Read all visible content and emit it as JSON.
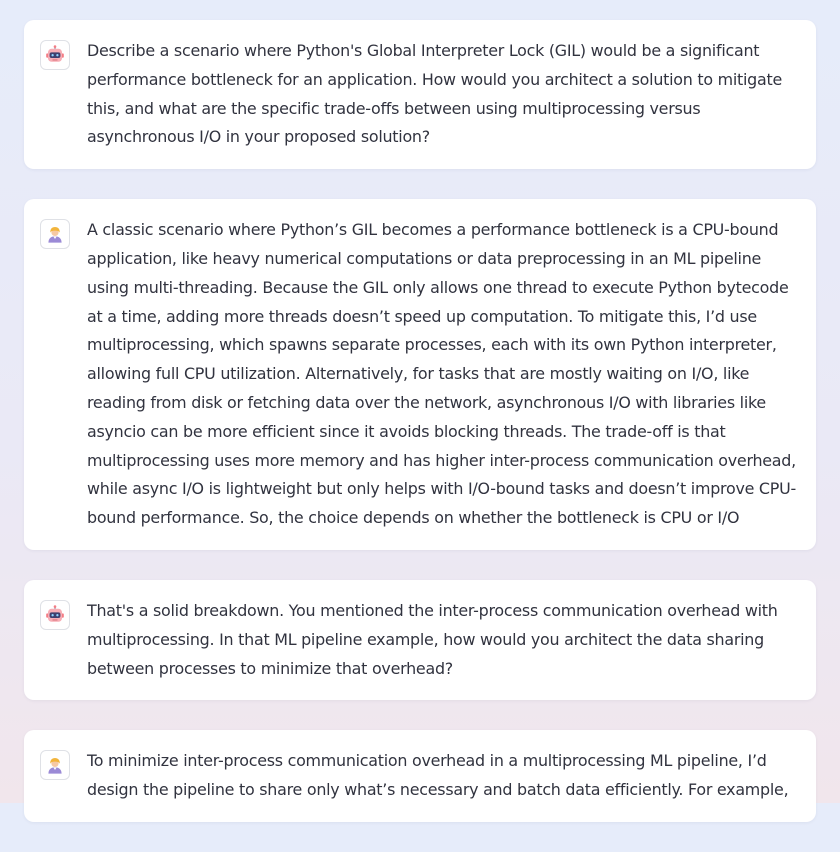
{
  "messages": [
    {
      "role": "assistant",
      "avatar_icon": "robot-icon",
      "text": "Describe a scenario where Python's Global Interpreter Lock (GIL) would be a significant performance bottleneck for an application. How would you architect a solution to mitigate this, and what are the specific trade-offs between using multiprocessing versus asynchronous I/O in your proposed solution?"
    },
    {
      "role": "user",
      "avatar_icon": "user-icon",
      "text": "A classic scenario where Python’s GIL becomes a performance bottleneck is a CPU-bound application, like heavy numerical computations or data preprocessing in an ML pipeline using multi-threading. Because the GIL only allows one thread to execute Python bytecode at a time, adding more threads doesn’t speed up computation. To mitigate this, I’d use multiprocessing, which spawns separate processes, each with its own Python interpreter, allowing full CPU utilization. Alternatively, for tasks that are mostly waiting on I/O, like reading from disk or fetching data over the network, asynchronous I/O with libraries like asyncio can be more efficient since it avoids blocking threads. The trade-off is that multiprocessing uses more memory and has higher inter-process communication overhead, while async I/O is lightweight but only helps with I/O-bound tasks and doesn’t improve CPU-bound performance. So, the choice depends on whether the bottleneck is CPU or I/O"
    },
    {
      "role": "assistant",
      "avatar_icon": "robot-icon",
      "text": "That's a solid breakdown. You mentioned the inter-process communication overhead with multiprocessing. In that ML pipeline example, how would you architect the data sharing between processes to minimize that overhead?"
    },
    {
      "role": "user",
      "avatar_icon": "user-icon",
      "text": "To minimize inter-process communication overhead in a multiprocessing ML pipeline, I’d design the pipeline to share only what’s necessary and batch data efficiently. For example,"
    }
  ]
}
